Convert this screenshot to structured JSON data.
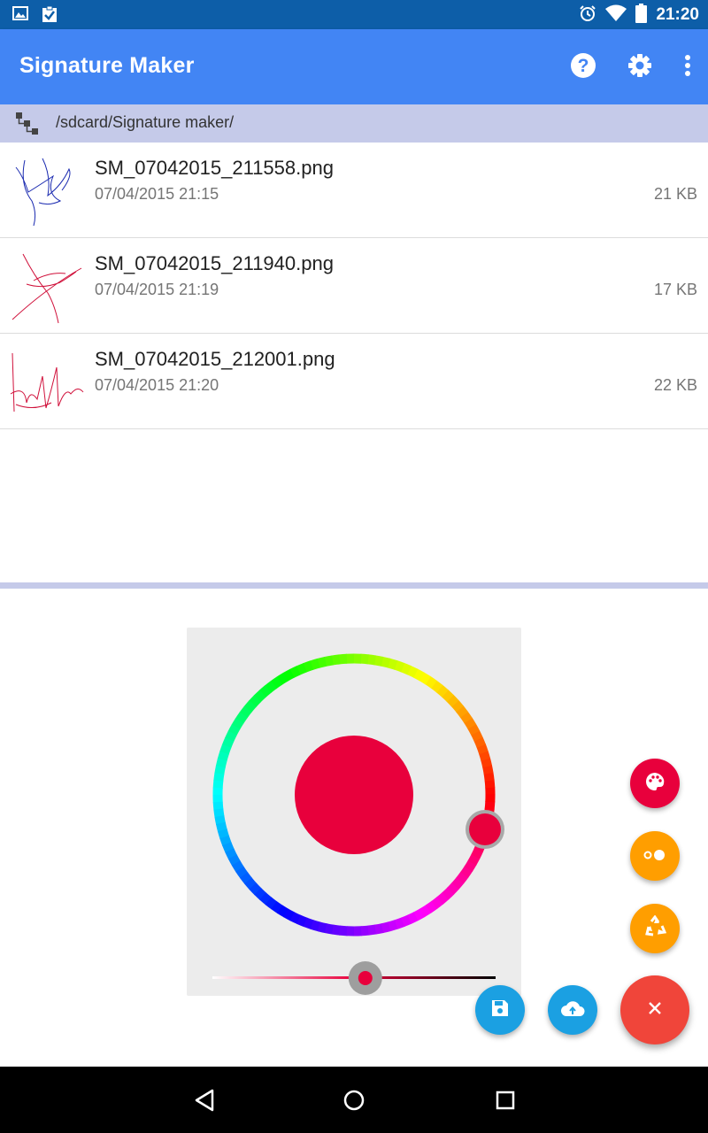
{
  "status_bar": {
    "time": "21:20",
    "icons": [
      "image-icon",
      "clipboard-check-icon",
      "alarm-icon",
      "wifi-icon",
      "battery-icon"
    ]
  },
  "app_bar": {
    "title": "Signature Maker",
    "actions": [
      "help-icon",
      "settings-gear-icon",
      "overflow-menu-icon"
    ]
  },
  "path_bar": {
    "path": "/sdcard/Signature maker/",
    "icon": "folder-tree-icon"
  },
  "files": [
    {
      "name": "SM_07042015_211558.png",
      "date": "07/04/2015 21:15",
      "size": "21 KB",
      "ink_color": "#1a2ab0"
    },
    {
      "name": "SM_07042015_211940.png",
      "date": "07/04/2015 21:19",
      "size": "17 KB",
      "ink_color": "#d0103a"
    },
    {
      "name": "SM_07042015_212001.png",
      "date": "07/04/2015 21:20",
      "size": "22 KB",
      "ink_color": "#d0103a"
    }
  ],
  "color_picker": {
    "selected_color": "#e8003c",
    "value_level": 0.54
  },
  "fabs": [
    {
      "name": "palette",
      "icon": "palette-icon",
      "color": "#e8003c"
    },
    {
      "name": "stroke-size",
      "icon": "dots-icon",
      "color": "#ff9e00"
    },
    {
      "name": "clear",
      "icon": "recycle-icon",
      "color": "#ff9e00"
    },
    {
      "name": "save",
      "icon": "save-icon",
      "color": "#1ba0e2"
    },
    {
      "name": "upload",
      "icon": "cloud-upload-icon",
      "color": "#1ba0e2"
    },
    {
      "name": "close",
      "icon": "close-icon",
      "color": "#f0453a"
    }
  ],
  "nav_bar": {
    "icons": [
      "back-icon",
      "home-icon",
      "recents-icon"
    ]
  }
}
